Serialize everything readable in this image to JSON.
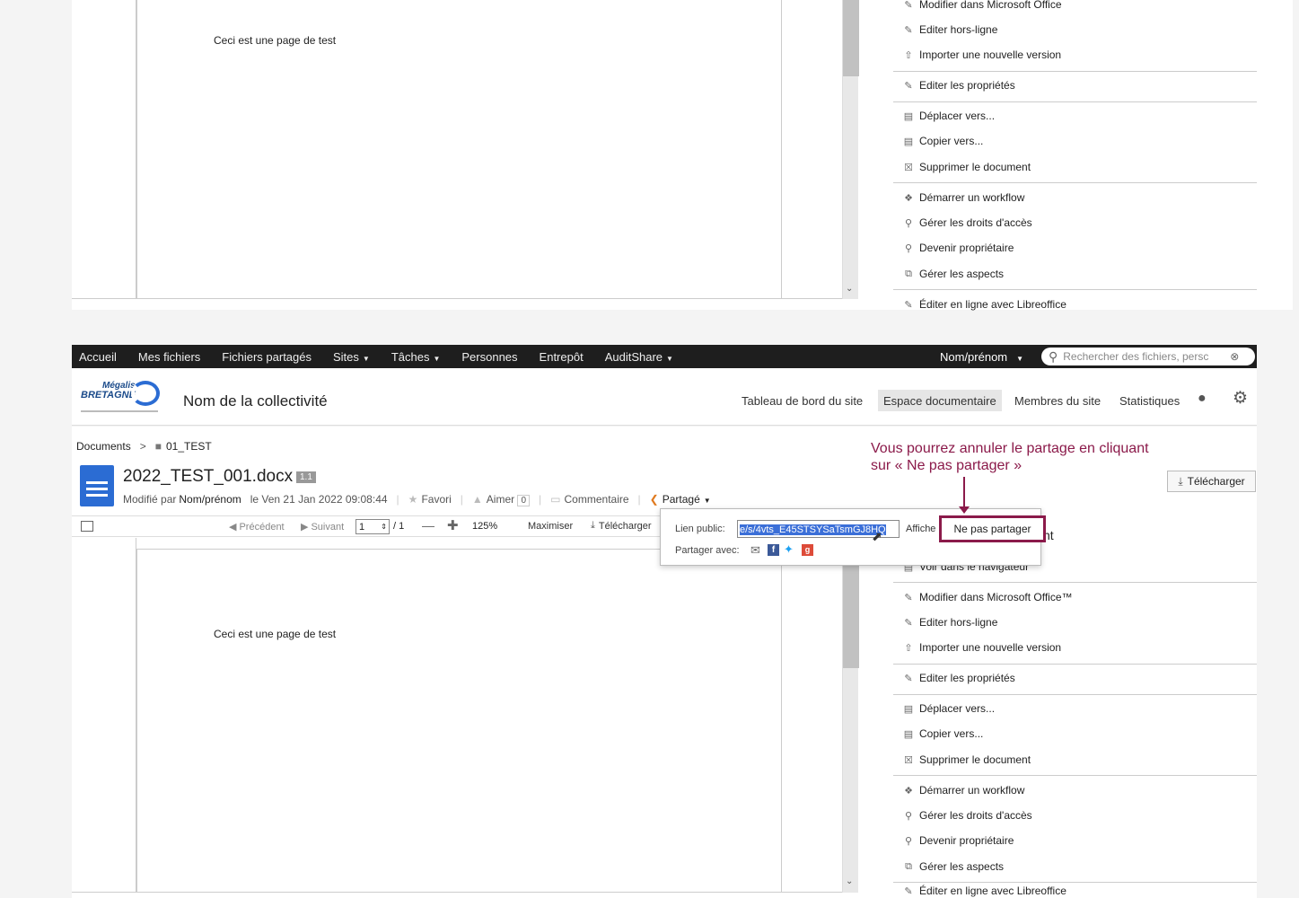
{
  "top_section": {
    "doc_text": "Ceci est une page de test",
    "actions": [
      "Modifier dans Microsoft Office",
      "Editer hors-ligne",
      "Importer une nouvelle version",
      "Editer les propriétés",
      "Déplacer vers...",
      "Copier vers...",
      "Supprimer le document",
      "Démarrer un workflow",
      "Gérer les droits d'accès",
      "Devenir propriétaire",
      "Gérer les aspects",
      "Éditer en ligne avec Libreoffice"
    ]
  },
  "navbar": {
    "items": [
      "Accueil",
      "Mes fichiers",
      "Fichiers partagés",
      "Sites",
      "Tâches",
      "Personnes",
      "Entrepôt",
      "AuditShare"
    ],
    "user": "Nom/prénom",
    "search_placeholder": "Rechercher des fichiers, persc"
  },
  "site_header": {
    "logo_top": "Mégalis",
    "logo_bottom": "BRETAGNE",
    "site_name": "Nom de la collectivité",
    "tabs": [
      "Tableau de bord du site",
      "Espace documentaire",
      "Membres du site",
      "Statistiques"
    ]
  },
  "breadcrumb": {
    "root": "Documents",
    "sep": ">",
    "folder": "01_TEST"
  },
  "document": {
    "filename": "2022_TEST_001.docx",
    "version": "1.1",
    "modified_by_label": "Modifié par",
    "modified_by": "Nom/prénom",
    "modified_date": "le Ven 21 Jan 2022 09:08:44",
    "favori": "Favori",
    "aimer": "Aimer",
    "aimer_count": "0",
    "commentaire": "Commentaire",
    "partage": "Partagé",
    "download": "Télécharger"
  },
  "viewer": {
    "prev": "Précédent",
    "next": "Suivant",
    "page": "1",
    "total": "/ 1",
    "zoom": "125%",
    "maximize": "Maximiser",
    "download": "Télécharger",
    "doc_text": "Ceci est une page de test"
  },
  "share_popup": {
    "link_label": "Lien public:",
    "link_value": "e/s/4vts_E45STSYSaTsmGJ8HQ",
    "view_label": "Affiche",
    "unshare": "Ne pas partager",
    "share_with": "Partager avec:"
  },
  "annotation": {
    "text": "Vous pourrez annuler le partage en cliquant sur « Ne pas partager »"
  },
  "bottom_actions": {
    "partial_label": "nt",
    "items": [
      "Voir dans le navigateur",
      "Modifier dans Microsoft Office™",
      "Editer hors-ligne",
      "Importer une nouvelle version",
      "Editer les propriétés",
      "Déplacer vers...",
      "Copier vers...",
      "Supprimer le document",
      "Démarrer un workflow",
      "Gérer les droits d'accès",
      "Devenir propriétaire",
      "Gérer les aspects",
      "Éditer en ligne avec Libreoffice"
    ]
  },
  "colors": {
    "navbar": "#1e1e1e",
    "annotation": "#8b1a4a",
    "link_highlight": "#3b6fd8",
    "doc_icon": "#2b6cd3"
  }
}
